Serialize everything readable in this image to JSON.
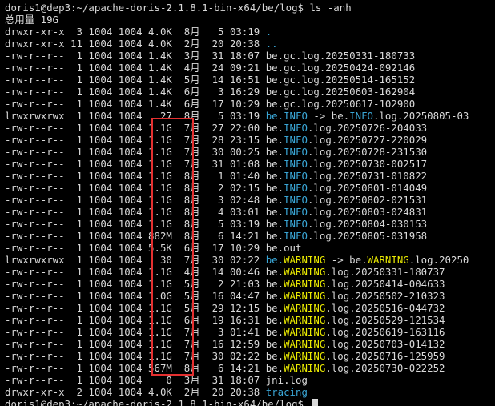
{
  "terminal": {
    "prompt": "doris1@dep3:~/apache-doris-2.1.8.1-bin-x64/be/log$",
    "command": " ls -anh",
    "total": "总用量 19G",
    "entries": [
      {
        "meta": "drwxr-xr-x  3 1004 1004 4.0K  8月   5 03:19 ",
        "name": ".",
        "name_color": "cyan"
      },
      {
        "meta": "drwxr-xr-x 11 1004 1004 4.0K  2月  20 20:38 ",
        "name": "..",
        "name_color": "cyan"
      },
      {
        "meta": "-rw-r--r--  1 1004 1004 1.4K  3月  31 18:07 ",
        "name": "be.gc.log.20250331-180733"
      },
      {
        "meta": "-rw-r--r--  1 1004 1004 1.4K  4月  24 09:21 ",
        "name": "be.gc.log.20250424-092146"
      },
      {
        "meta": "-rw-r--r--  1 1004 1004 1.4K  5月  14 16:51 ",
        "name": "be.gc.log.20250514-165152"
      },
      {
        "meta": "-rw-r--r--  1 1004 1004 1.4K  6月   3 16:29 ",
        "name": "be.gc.log.20250603-162904"
      },
      {
        "meta": "-rw-r--r--  1 1004 1004 1.4K  6月  17 10:29 ",
        "name": "be.gc.log.20250617-102900"
      },
      {
        "meta": "lrwxrwxrwx  1 1004 1004   27  8月   5 03:19 ",
        "symlink": true,
        "kind": "INFO",
        "target": ".log.20250805-03"
      },
      {
        "meta": "-rw-r--r--  1 1004 1004 1.1G  7月  27 22:00 ",
        "kind": "INFO",
        "suffix": ".log.20250726-204033"
      },
      {
        "meta": "-rw-r--r--  1 1004 1004 1.1G  7月  28 23:15 ",
        "kind": "INFO",
        "suffix": ".log.20250727-220029"
      },
      {
        "meta": "-rw-r--r--  1 1004 1004 1.1G  7月  30 00:25 ",
        "kind": "INFO",
        "suffix": ".log.20250728-231530"
      },
      {
        "meta": "-rw-r--r--  1 1004 1004 1.1G  7月  31 01:08 ",
        "kind": "INFO",
        "suffix": ".log.20250730-002517"
      },
      {
        "meta": "-rw-r--r--  1 1004 1004 1.1G  8月   1 01:40 ",
        "kind": "INFO",
        "suffix": ".log.20250731-010822"
      },
      {
        "meta": "-rw-r--r--  1 1004 1004 1.1G  8月   2 02:15 ",
        "kind": "INFO",
        "suffix": ".log.20250801-014049"
      },
      {
        "meta": "-rw-r--r--  1 1004 1004 1.1G  8月   3 02:48 ",
        "kind": "INFO",
        "suffix": ".log.20250802-021531"
      },
      {
        "meta": "-rw-r--r--  1 1004 1004 1.1G  8月   4 03:01 ",
        "kind": "INFO",
        "suffix": ".log.20250803-024831"
      },
      {
        "meta": "-rw-r--r--  1 1004 1004 1.1G  8月   5 03:19 ",
        "kind": "INFO",
        "suffix": ".log.20250804-030153"
      },
      {
        "meta": "-rw-r--r--  1 1004 1004 882M  8月   6 14:21 ",
        "kind": "INFO",
        "suffix": ".log.20250805-031958"
      },
      {
        "meta": "-rw-r--r--  1 1004 1004 5.5K  6月  17 10:29 ",
        "name": "be.out"
      },
      {
        "meta": "lrwxrwxrwx  1 1004 1004   30  7月  30 02:22 ",
        "symlink": true,
        "kind": "WARNING",
        "target": ".log.20250"
      },
      {
        "meta": "-rw-r--r--  1 1004 1004 1.1G  4月  14 00:46 ",
        "kind": "WARNING",
        "suffix": ".log.20250331-180737"
      },
      {
        "meta": "-rw-r--r--  1 1004 1004 1.1G  5月   2 21:03 ",
        "kind": "WARNING",
        "suffix": ".log.20250414-004633"
      },
      {
        "meta": "-rw-r--r--  1 1004 1004 1.0G  5月  16 04:47 ",
        "kind": "WARNING",
        "suffix": ".log.20250502-210323"
      },
      {
        "meta": "-rw-r--r--  1 1004 1004 1.1G  5月  29 12:15 ",
        "kind": "WARNING",
        "suffix": ".log.20250516-044732"
      },
      {
        "meta": "-rw-r--r--  1 1004 1004 1.1G  6月  19 16:31 ",
        "kind": "WARNING",
        "suffix": ".log.20250529-121534"
      },
      {
        "meta": "-rw-r--r--  1 1004 1004 1.1G  7月   3 01:41 ",
        "kind": "WARNING",
        "suffix": ".log.20250619-163116"
      },
      {
        "meta": "-rw-r--r--  1 1004 1004 1.1G  7月  16 12:59 ",
        "kind": "WARNING",
        "suffix": ".log.20250703-014132"
      },
      {
        "meta": "-rw-r--r--  1 1004 1004 1.1G  7月  30 02:22 ",
        "kind": "WARNING",
        "suffix": ".log.20250716-125959"
      },
      {
        "meta": "-rw-r--r--  1 1004 1004 567M  8月   6 14:21 ",
        "kind": "WARNING",
        "suffix": ".log.20250730-022252"
      },
      {
        "meta": "-rw-r--r--  1 1004 1004    0  3月  31 18:07 ",
        "name": "jni.log"
      },
      {
        "meta": "drwxr-xr-x  2 1004 1004 4.0K  2月  20 20:38 ",
        "name": "tracing",
        "name_color": "cyan"
      }
    ],
    "be_prefix": "be.",
    "arrow": " -> ",
    "final_prompt": "doris1@dep3:~/apache-doris-2.1.8.1-bin-x64/be/log$ "
  },
  "colors": {
    "background": "#000000",
    "text": "#d9d9d9",
    "dir_and_link": "#3aa6d6",
    "warning_keyword": "#e8e800",
    "highlight_box": "#e53030"
  }
}
